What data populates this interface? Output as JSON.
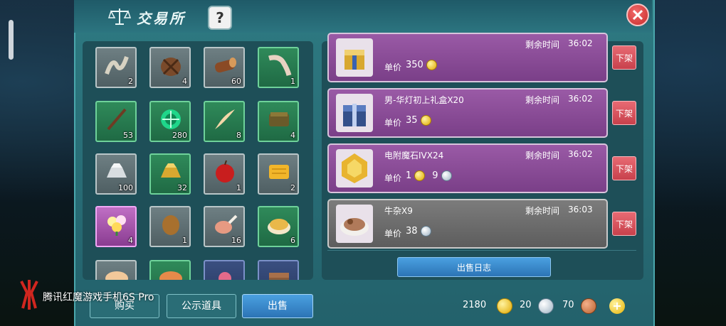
{
  "header": {
    "title": "交易所",
    "help_label": "?"
  },
  "inventory": [
    {
      "icon": "rope-icon",
      "count": "2"
    },
    {
      "icon": "wood-bundle-icon",
      "count": "4"
    },
    {
      "icon": "log-icon",
      "count": "60"
    },
    {
      "icon": "worm-icon",
      "count": "1"
    },
    {
      "icon": "stick-icon",
      "count": "53"
    },
    {
      "icon": "green-orb-icon",
      "count": "280"
    },
    {
      "icon": "feather-icon",
      "count": "8"
    },
    {
      "icon": "leather-icon",
      "count": "4"
    },
    {
      "icon": "silver-ingot-icon",
      "count": "100"
    },
    {
      "icon": "gold-ingot-icon",
      "count": "32"
    },
    {
      "icon": "apple-icon",
      "count": "1"
    },
    {
      "icon": "honeycomb-icon",
      "count": "2"
    },
    {
      "icon": "flower-bouquet-icon",
      "count": "4"
    },
    {
      "icon": "potato-icon",
      "count": "1"
    },
    {
      "icon": "meat-leg-icon",
      "count": "16"
    },
    {
      "icon": "fried-rice-icon",
      "count": "6"
    },
    {
      "icon": "dish-icon",
      "count": ""
    },
    {
      "icon": "dish-icon",
      "count": ""
    },
    {
      "icon": "flower-icon",
      "count": ""
    },
    {
      "icon": "chest-icon",
      "count": ""
    }
  ],
  "listings": [
    {
      "name": "",
      "time_label": "剩余时间",
      "time": "36:02",
      "price_label": "单价",
      "price_gold": "350",
      "price_silver": "",
      "icon": "gift-box-icon",
      "style": "purple"
    },
    {
      "name": "男-华灯初上礼盒X20",
      "time_label": "剩余时间",
      "time": "36:02",
      "price_label": "单价",
      "price_gold": "35",
      "price_silver": "",
      "icon": "blue-gift-icon",
      "style": "purple"
    },
    {
      "name": "电附魔石IVX24",
      "time_label": "剩余时间",
      "time": "36:02",
      "price_label": "单价",
      "price_gold": "1",
      "price_silver": "9",
      "icon": "gem-icon",
      "style": "purple"
    },
    {
      "name": "牛杂X9",
      "time_label": "剩余时间",
      "time": "36:03",
      "price_label": "单价",
      "price_gold": "",
      "price_silver": "38",
      "icon": "food-icon",
      "style": "gray"
    }
  ],
  "unlist_label": "下架",
  "sale_log_label": "出售日志",
  "tabs": {
    "buy": "购买",
    "public": "公示道具",
    "sell": "出售"
  },
  "currency": {
    "gold": "2180",
    "silver": "20",
    "bronze": "70",
    "add": "+"
  },
  "watermark": "腾讯红魔游戏手机6S Pro"
}
